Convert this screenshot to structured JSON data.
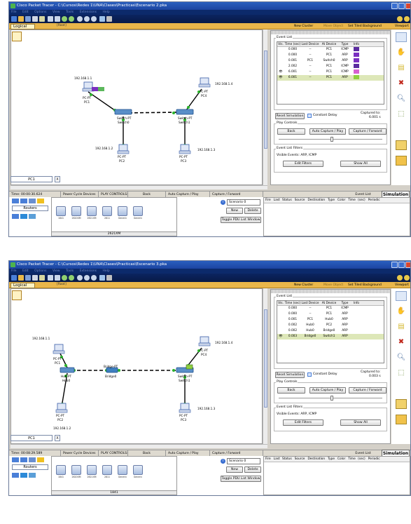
{
  "screenshots": [
    {
      "title": "Cisco Packet Tracer - C:\\Cursos\\Redes 1\\UNA\\Clases\\Practicas\\Escenario 2.pka",
      "menu": [
        "File",
        "Edit",
        "Options",
        "View",
        "Tools",
        "Extensions",
        "Help"
      ],
      "logical_label": "Logical",
      "root_label": "[Root]",
      "new_cluster": "New Cluster",
      "move_object": "Move Object",
      "set_bg": "Set Tiled Background",
      "viewport": "Viewport",
      "event_list_label": "Event List",
      "columns": [
        "Vis.",
        "Time (sec)",
        "Last Device",
        "At Device",
        "Type",
        "Info"
      ],
      "events": [
        {
          "time": "0.000",
          "last": "--",
          "at": "PC1",
          "type": "ICMP",
          "color": "#5b2ca0",
          "eye": false,
          "sel": false
        },
        {
          "time": "0.000",
          "last": "--",
          "at": "PC1",
          "type": "ARP",
          "color": "#7a2fc0",
          "eye": false,
          "sel": false
        },
        {
          "time": "0.001",
          "last": "PC1",
          "at": "Switch0",
          "type": "ARP",
          "color": "#7a2fc0",
          "eye": false,
          "sel": false
        },
        {
          "time": "2.002",
          "last": "--",
          "at": "PC1",
          "type": "ICMP",
          "color": "#5b2ca0",
          "eye": false,
          "sel": false
        },
        {
          "time": "6.001",
          "last": "--",
          "at": "PC1",
          "type": "ICMP",
          "color": "#d860d0",
          "eye": true,
          "sel": false
        },
        {
          "time": "6.001",
          "last": "--",
          "at": "PC1",
          "type": "ARP",
          "color": "#8fd040",
          "eye": true,
          "sel": true
        }
      ],
      "reset_label": "Reset Simulation",
      "constant_delay": "Constant Delay",
      "captured_to_label": "Captured to:",
      "captured_to_value": "6.001 s",
      "play_controls": "Play Controls",
      "back": "Back",
      "auto_capture": "Auto Capture / Play",
      "capture_forward": "Capture / Forward",
      "filters_label": "Event List Filters",
      "visible_events": "Visible Events: ARP, ICMP",
      "edit_filters": "Edit Filters",
      "show_all": "Show All",
      "page_box": "PC1",
      "page_x": "X",
      "status_time": "Time: 00:00:30.624",
      "power_cycle": "Power Cycle Devices",
      "play_controls_caps": "PLAY CONTROLS:",
      "sb_back": "Back",
      "sb_auto": "Auto Capture / Play",
      "sb_capture": "Capture / Forward",
      "sb_event_list": "Event List",
      "simulation_tab": "Simulation",
      "device_category": "Routers",
      "device_models": [
        "1841",
        "2620XM",
        "2621XM",
        "2811",
        "Generic",
        "Generic"
      ],
      "selected_model": "2621XM",
      "scenario": "Scenario 0",
      "new_btn": "New",
      "delete_btn": "Delete",
      "toggle_pdu": "Toggle PDU List Window",
      "pdu_cols": [
        "Fire",
        "Last Status",
        "Source",
        "Destination",
        "Type",
        "Color",
        "Time (sec)",
        "Periodic"
      ],
      "topology": {
        "ip_pc1": "192.168.1.1",
        "ip_pc4": "192.168.1.4",
        "ip_pc2": "192.168.1.2",
        "ip_pc3": "192.168.1.3",
        "pc1": [
          "PC-PT",
          "PC1"
        ],
        "pc4": [
          "PC-PT",
          "PC4"
        ],
        "pc2": [
          "PC-PT",
          "PC2"
        ],
        "pc3": [
          "PC-PT",
          "PC3"
        ],
        "sw0": [
          "Switch-PT",
          "Switch0"
        ],
        "sw1": [
          "Switch-PT",
          "Switch1"
        ]
      }
    },
    {
      "title": "Cisco Packet Tracer - C:\\Cursos\\Redes 1\\UNA\\Clases\\Practicas\\Escenario 3.pka",
      "menu": [
        "File",
        "Edit",
        "Options",
        "View",
        "Tools",
        "Extensions",
        "Help"
      ],
      "logical_label": "Logical",
      "root_label": "[Root]",
      "new_cluster": "New Cluster",
      "move_object": "Move Object",
      "set_bg": "Set Tiled Background",
      "viewport": "Viewport",
      "event_list_label": "Event List",
      "columns": [
        "Vis.",
        "Time (sec)",
        "Last Device",
        "At Device",
        "Type",
        "Info"
      ],
      "events": [
        {
          "time": "0.000",
          "last": "--",
          "at": "PC1",
          "type": "ICMP",
          "color": "",
          "eye": false,
          "sel": false
        },
        {
          "time": "0.000",
          "last": "--",
          "at": "PC1",
          "type": "ARP",
          "color": "",
          "eye": false,
          "sel": false
        },
        {
          "time": "0.001",
          "last": "PC1",
          "at": "Hub0",
          "type": "ARP",
          "color": "",
          "eye": false,
          "sel": false
        },
        {
          "time": "0.002",
          "last": "Hub0",
          "at": "PC2",
          "type": "ARP",
          "color": "",
          "eye": false,
          "sel": false
        },
        {
          "time": "0.002",
          "last": "Hub0",
          "at": "Bridge0",
          "type": "ARP",
          "color": "",
          "eye": false,
          "sel": false
        },
        {
          "time": "0.003",
          "last": "Bridge0",
          "at": "Switch1",
          "type": "ARP",
          "color": "",
          "eye": true,
          "sel": true
        }
      ],
      "reset_label": "Reset Simulation",
      "constant_delay": "Constant Delay",
      "captured_to_label": "Captured to:",
      "captured_to_value": "0.003 s",
      "play_controls": "Play Controls",
      "back": "Back",
      "auto_capture": "Auto Capture / Play",
      "capture_forward": "Capture / Forward",
      "filters_label": "Event List Filters",
      "visible_events": "Visible Events: ARP, ICMP",
      "edit_filters": "Edit Filters",
      "show_all": "Show All",
      "page_box": "PC1",
      "page_x": "X",
      "status_time": "Time: 00:08:29.589",
      "power_cycle": "Power Cycle Devices",
      "play_controls_caps": "PLAY CONTROLS:",
      "sb_back": "Back",
      "sb_auto": "Auto Capture / Play",
      "sb_capture": "Capture / Forward",
      "sb_event_list": "Event List",
      "simulation_tab": "Simulation",
      "device_category": "Routers",
      "device_models": [
        "1841",
        "2620XM",
        "2621XM",
        "2811",
        "Generic",
        "Generic"
      ],
      "selected_model": "1841",
      "scenario": "Scenario 0",
      "new_btn": "New",
      "delete_btn": "Delete",
      "toggle_pdu": "Toggle PDU List Window",
      "pdu_cols": [
        "Fire",
        "Last Status",
        "Source",
        "Destination",
        "Type",
        "Color",
        "Time (sec)",
        "Periodic"
      ],
      "topology": {
        "ip_pc1": "192.168.1.1",
        "ip_pc4": "192.168.1.4",
        "ip_pc2": "192.168.1.2",
        "ip_pc3": "192.168.1.3",
        "pc1": [
          "PC-PT",
          "PC1"
        ],
        "pc4": [
          "PC-PT",
          "PC4"
        ],
        "pc2": [
          "PC-PT",
          "PC2"
        ],
        "pc3": [
          "PC-PT",
          "PC3"
        ],
        "hub0": [
          "Hub-PT",
          "Hub0"
        ],
        "bridge0": [
          "Bridge-PT",
          "Bridge0"
        ],
        "sw1": [
          "Switch-PT",
          "Switch1"
        ]
      }
    }
  ]
}
